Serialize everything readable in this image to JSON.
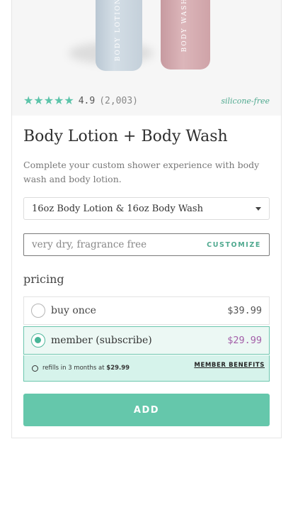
{
  "hero": {
    "lotion_label": "BODY LOTION",
    "wash_label": "BODY WASH"
  },
  "rating": {
    "stars_glyph": "★★★★★",
    "score": "4.9",
    "count": "(2,003)",
    "tag": "silicone-free"
  },
  "product": {
    "title": "Body Lotion + Body Wash",
    "description": "Complete your custom shower experience with body wash and body lotion."
  },
  "size_select": {
    "selected": "16oz Body Lotion & 16oz Body Wash"
  },
  "customize": {
    "value": "very dry, fragrance free",
    "button_label": "CUSTOMIZE"
  },
  "pricing": {
    "label": "pricing",
    "options": [
      {
        "label": "buy once",
        "price": "$39.99",
        "selected": false
      },
      {
        "label": "member (subscribe)",
        "price": "$29.99",
        "selected": true
      }
    ],
    "refill_prefix": "refills in 3 months at ",
    "refill_price": "$29.99",
    "member_benefits_label": "MEMBER BENEFITS"
  },
  "actions": {
    "add_label": "ADD"
  },
  "colors": {
    "accent": "#65c7ab",
    "member_price": "#a35ea8",
    "star": "#5cc4aa"
  }
}
